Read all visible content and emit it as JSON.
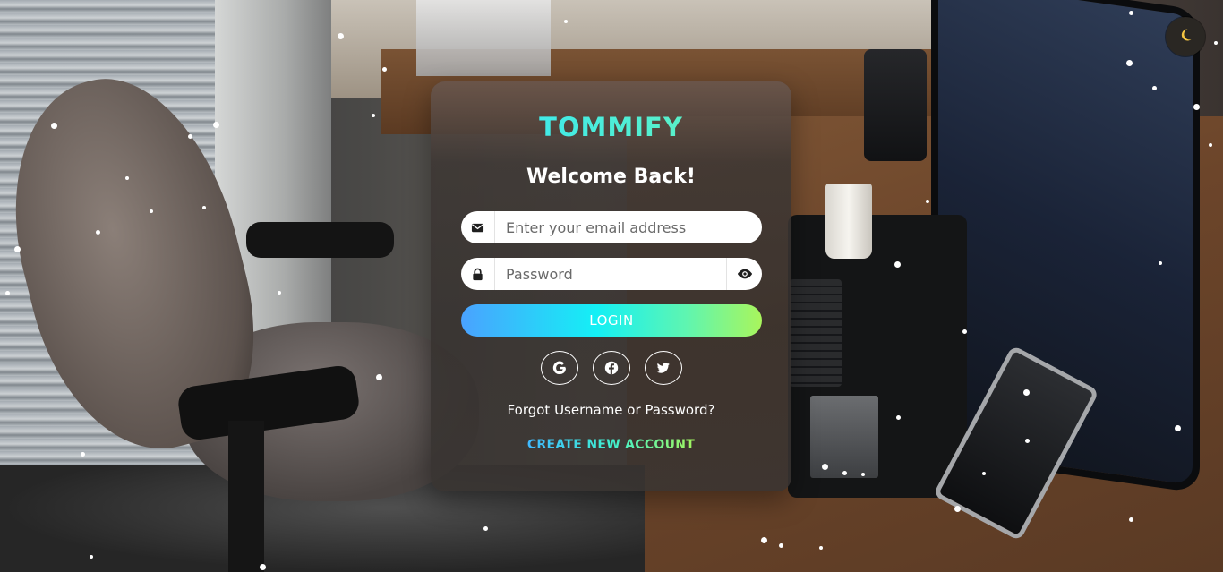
{
  "theme_toggle": {
    "icon": "moon-icon",
    "color": "#f5c542"
  },
  "card": {
    "brand": "TOMMIFY",
    "heading": "Welcome Back!",
    "email": {
      "placeholder": "Enter your email address",
      "value": "",
      "icon": "envelope-icon"
    },
    "password": {
      "placeholder": "Password",
      "value": "",
      "icon": "lock-icon",
      "toggle_icon": "eye-icon"
    },
    "login_label": "LOGIN",
    "socials": [
      {
        "name": "google",
        "icon": "google-icon"
      },
      {
        "name": "facebook",
        "icon": "facebook-icon"
      },
      {
        "name": "twitter",
        "icon": "twitter-icon"
      }
    ],
    "forgot_label": "Forgot Username or Password?",
    "create_label": "CREATE NEW ACCOUNT"
  },
  "colors": {
    "brand_gradient": [
      "#2ee6ff",
      "#6cf5b2"
    ],
    "button_gradient": [
      "#4aa2ff",
      "#14f0f5",
      "#5ff5b0",
      "#a9f55c"
    ]
  }
}
